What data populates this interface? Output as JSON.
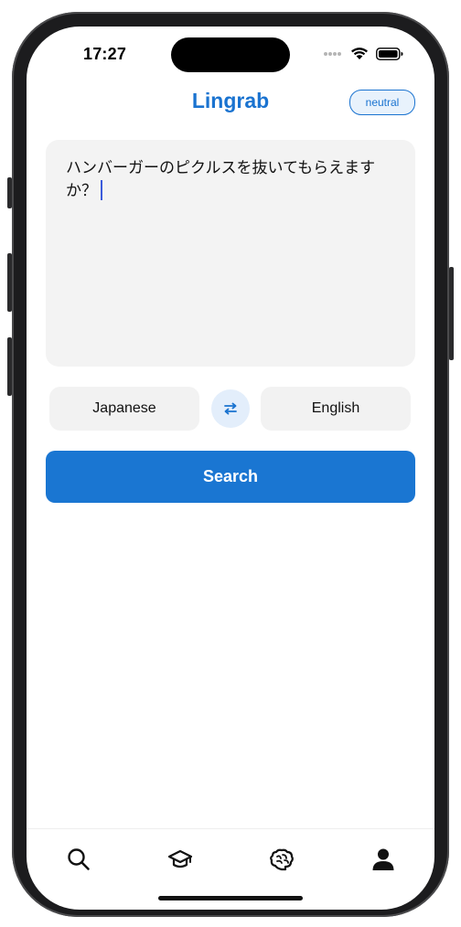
{
  "status_bar": {
    "time": "17:27"
  },
  "header": {
    "title": "Lingrab",
    "mode_badge": "neutral"
  },
  "input": {
    "text": "ハンバーガーのピクルスを抜いてもらえますか？"
  },
  "languages": {
    "source": "Japanese",
    "target": "English"
  },
  "actions": {
    "search_label": "Search"
  },
  "tabs": [
    {
      "icon": "search-icon"
    },
    {
      "icon": "graduation-cap-icon"
    },
    {
      "icon": "brain-icon"
    },
    {
      "icon": "user-icon"
    }
  ],
  "colors": {
    "accent": "#1a76d2",
    "input_bg": "#f3f3f3"
  }
}
